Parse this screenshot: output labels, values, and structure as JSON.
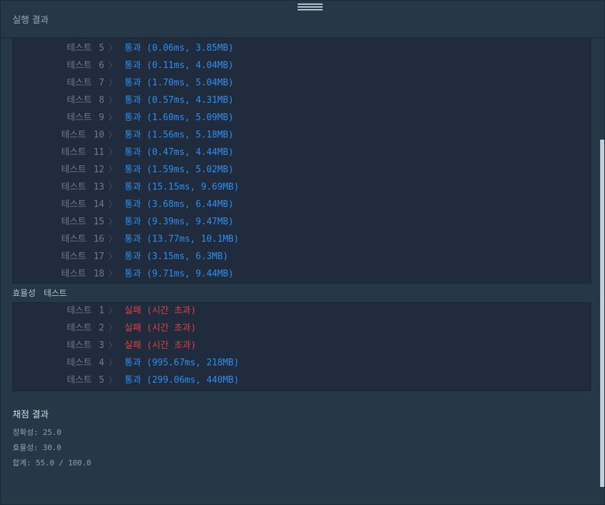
{
  "header": {
    "title": "실행 결과"
  },
  "accuracy_tests": [
    {
      "label": "테스트",
      "num": "5",
      "status": "통과",
      "detail": "(0.06ms, 3.85MB)",
      "pass": true
    },
    {
      "label": "테스트",
      "num": "6",
      "status": "통과",
      "detail": "(0.11ms, 4.04MB)",
      "pass": true
    },
    {
      "label": "테스트",
      "num": "7",
      "status": "통과",
      "detail": "(1.70ms, 5.04MB)",
      "pass": true
    },
    {
      "label": "테스트",
      "num": "8",
      "status": "통과",
      "detail": "(0.57ms, 4.31MB)",
      "pass": true
    },
    {
      "label": "테스트",
      "num": "9",
      "status": "통과",
      "detail": "(1.60ms, 5.09MB)",
      "pass": true
    },
    {
      "label": "테스트",
      "num": "10",
      "status": "통과",
      "detail": "(1.56ms, 5.18MB)",
      "pass": true
    },
    {
      "label": "테스트",
      "num": "11",
      "status": "통과",
      "detail": "(0.47ms, 4.44MB)",
      "pass": true
    },
    {
      "label": "테스트",
      "num": "12",
      "status": "통과",
      "detail": "(1.59ms, 5.02MB)",
      "pass": true
    },
    {
      "label": "테스트",
      "num": "13",
      "status": "통과",
      "detail": "(15.15ms, 9.69MB)",
      "pass": true
    },
    {
      "label": "테스트",
      "num": "14",
      "status": "통과",
      "detail": "(3.68ms, 6.44MB)",
      "pass": true
    },
    {
      "label": "테스트",
      "num": "15",
      "status": "통과",
      "detail": "(9.39ms, 9.47MB)",
      "pass": true
    },
    {
      "label": "테스트",
      "num": "16",
      "status": "통과",
      "detail": "(13.77ms, 10.1MB)",
      "pass": true
    },
    {
      "label": "테스트",
      "num": "17",
      "status": "통과",
      "detail": "(3.15ms, 6.3MB)",
      "pass": true
    },
    {
      "label": "테스트",
      "num": "18",
      "status": "통과",
      "detail": "(9.71ms, 9.44MB)",
      "pass": true
    }
  ],
  "efficiency_section": {
    "label": "효율성 테스트"
  },
  "efficiency_tests": [
    {
      "label": "테스트",
      "num": "1",
      "status": "실패",
      "detail": "(시간 초과)",
      "pass": false
    },
    {
      "label": "테스트",
      "num": "2",
      "status": "실패",
      "detail": "(시간 초과)",
      "pass": false
    },
    {
      "label": "테스트",
      "num": "3",
      "status": "실패",
      "detail": "(시간 초과)",
      "pass": false
    },
    {
      "label": "테스트",
      "num": "4",
      "status": "통과",
      "detail": "(995.67ms, 218MB)",
      "pass": true
    },
    {
      "label": "테스트",
      "num": "5",
      "status": "통과",
      "detail": "(299.06ms, 440MB)",
      "pass": true
    }
  ],
  "grading": {
    "title": "채점 결과",
    "accuracy": "정확성: 25.0",
    "efficiency": "효율성: 30.0",
    "total": "합계: 55.0 / 100.0"
  },
  "colors": {
    "pass": "#2e8ef0",
    "fail": "#e04040",
    "chevron_icon": "chevron-right"
  }
}
